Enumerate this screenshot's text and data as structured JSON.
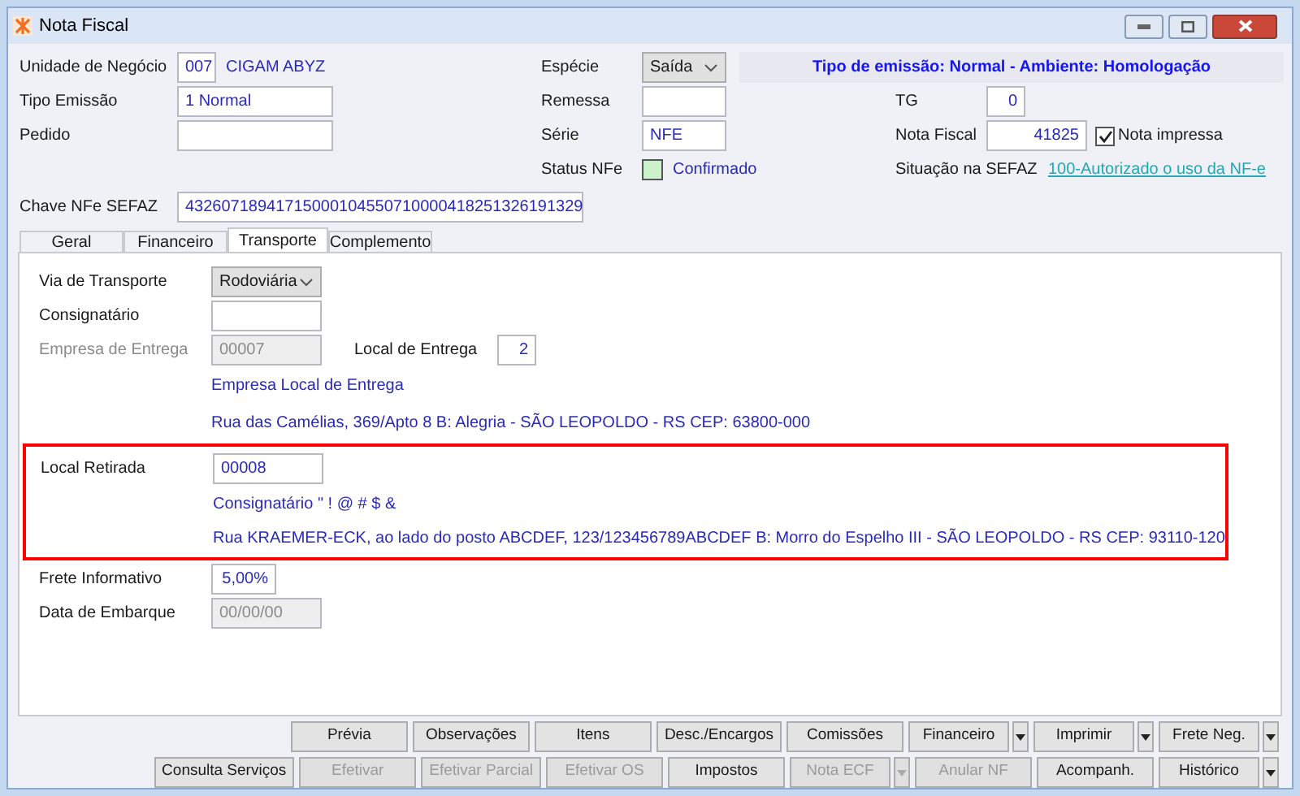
{
  "window": {
    "title": "Nota Fiscal"
  },
  "header": {
    "unidade": {
      "label": "Unidade de Negócio",
      "code": "007",
      "name": "CIGAM ABYZ"
    },
    "especie": {
      "label": "Espécie",
      "value": "Saída"
    },
    "banner": "Tipo de emissão: Normal - Ambiente: Homologação",
    "tipo_emissao": {
      "label": "Tipo Emissão",
      "value": "1 Normal"
    },
    "remessa": {
      "label": "Remessa"
    },
    "tg": {
      "label": "TG",
      "value": "0"
    },
    "pedido": {
      "label": "Pedido"
    },
    "serie": {
      "label": "Série",
      "value": "NFE"
    },
    "nota_fiscal": {
      "label": "Nota Fiscal",
      "value": "41825"
    },
    "nota_impressa": {
      "label": "Nota impressa",
      "checked": true
    },
    "status_nfe": {
      "label": "Status NFe",
      "value": "Confirmado"
    },
    "situacao": {
      "label": "Situação na SEFAZ",
      "link": "100-Autorizado o uso da NF-e"
    },
    "chave": {
      "label": "Chave NFe SEFAZ",
      "value": "43260718941715000104550710000418251326191329"
    }
  },
  "tabs": [
    {
      "label": "Geral",
      "selected": false
    },
    {
      "label": "Financeiro",
      "selected": false
    },
    {
      "label": "Transporte",
      "selected": true
    },
    {
      "label": "Complemento",
      "selected": false
    }
  ],
  "transporte": {
    "via": {
      "label": "Via de Transporte",
      "value": "Rodoviária"
    },
    "consignatario": {
      "label": "Consignatário"
    },
    "empresa_entrega": {
      "label": "Empresa de Entrega",
      "value": "00007",
      "disabled": true
    },
    "local_entrega": {
      "label": "Local de Entrega",
      "value": "2"
    },
    "entrega_nome": "Empresa Local de Entrega",
    "entrega_endereco": "Rua das Camélias, 369/Apto 8 B: Alegria - SÃO LEOPOLDO - RS CEP: 63800-000",
    "local_retirada": {
      "label": "Local Retirada",
      "value": "00008",
      "highlighted": true
    },
    "retirada_nome": "Consignatário \" ! @ # $ &",
    "retirada_endereco": "Rua KRAEMER-ECK, ao lado do posto ABCDEF, 123/123456789ABCDEF B: Morro do Espelho III - SÃO LEOPOLDO - RS CEP: 93110-120",
    "frete": {
      "label": "Frete Informativo",
      "value": "5,00%"
    },
    "embarque": {
      "label": "Data de Embarque",
      "value": "00/00/00",
      "disabled": true
    }
  },
  "buttons": [
    [
      {
        "label": "Prévia",
        "disabled": false,
        "dropdown": false
      },
      {
        "label": "Observações",
        "disabled": false,
        "dropdown": false
      },
      {
        "label": "Itens",
        "disabled": false,
        "dropdown": false
      },
      {
        "label": "Desc./Encargos",
        "disabled": false,
        "dropdown": false
      },
      {
        "label": "Comissões",
        "disabled": false,
        "dropdown": false
      },
      {
        "label": "Financeiro",
        "disabled": false,
        "dropdown": true
      },
      {
        "label": "Imprimir",
        "disabled": false,
        "dropdown": true
      },
      {
        "label": "Frete Neg.",
        "disabled": false,
        "dropdown": true
      }
    ],
    [
      {
        "label": "Consulta Serviços",
        "disabled": false,
        "dropdown": false
      },
      {
        "label": "Efetivar",
        "disabled": true,
        "dropdown": false
      },
      {
        "label": "Efetivar Parcial",
        "disabled": true,
        "dropdown": false
      },
      {
        "label": "Efetivar OS",
        "disabled": true,
        "dropdown": false
      },
      {
        "label": "Impostos",
        "disabled": false,
        "dropdown": false
      },
      {
        "label": "Nota ECF",
        "disabled": true,
        "dropdown": true
      },
      {
        "label": "Anular NF",
        "disabled": true,
        "dropdown": false
      },
      {
        "label": "Acompanh.",
        "disabled": false,
        "dropdown": false
      },
      {
        "label": "Histórico",
        "disabled": false,
        "dropdown": true
      }
    ]
  ]
}
